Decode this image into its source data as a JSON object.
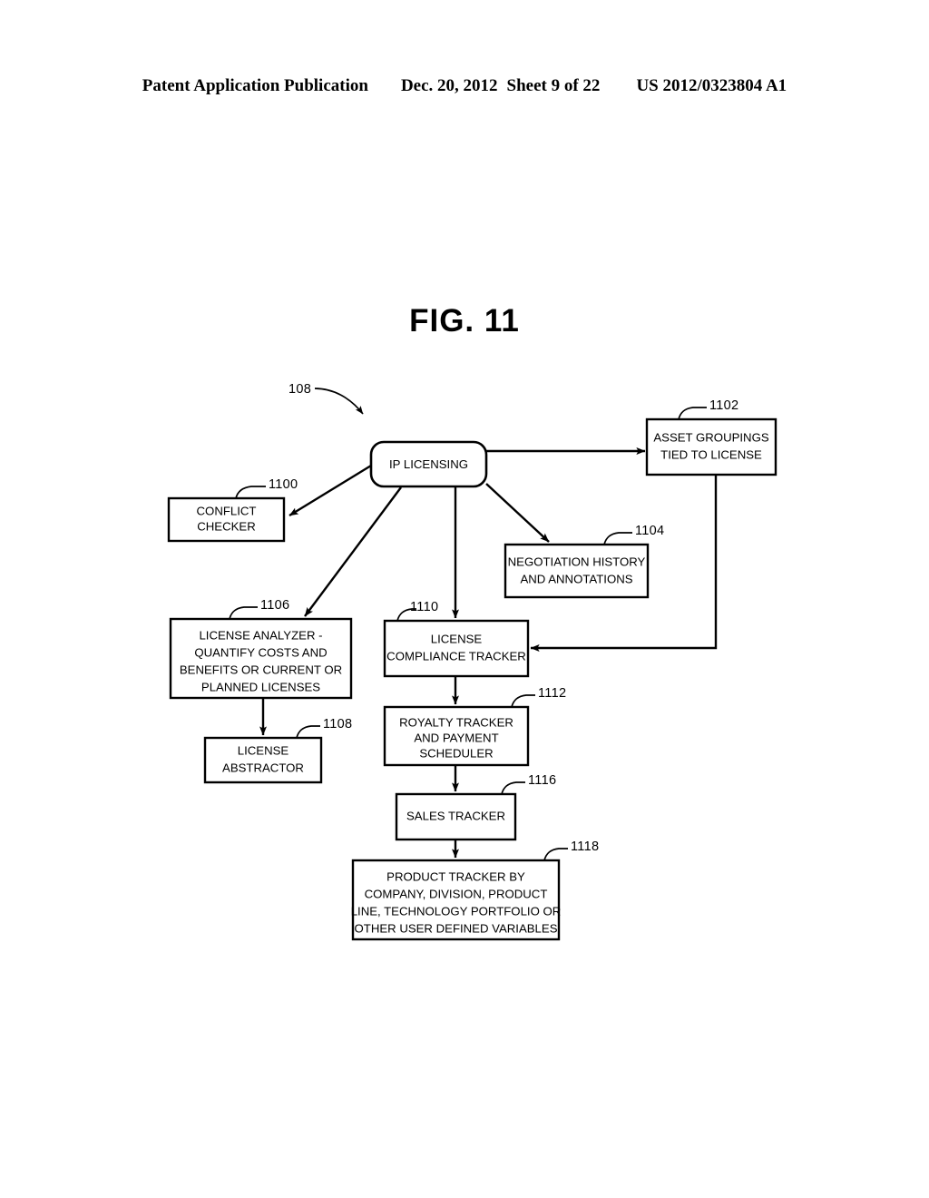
{
  "header": {
    "publication": "Patent Application Publication",
    "date": "Dec. 20, 2012",
    "sheet": "Sheet 9 of 22",
    "patent_number": "US 2012/0323804 A1"
  },
  "figure": {
    "title": "FIG. 11",
    "system_ref": "108"
  },
  "nodes": [
    {
      "id": "ip-licensing",
      "ref": "108",
      "label": "IP LICENSING",
      "lines": [
        "IP LICENSING"
      ],
      "shape": "rounded-rect"
    },
    {
      "id": "conflict-checker",
      "ref": "1100",
      "label": "CONFLICT CHECKER",
      "lines": [
        "CONFLICT",
        "CHECKER"
      ],
      "shape": "rect"
    },
    {
      "id": "asset-groupings",
      "ref": "1102",
      "label": "ASSET GROUPINGS TIED TO LICENSE",
      "lines": [
        "ASSET GROUPINGS",
        "TIED TO LICENSE"
      ],
      "shape": "rect"
    },
    {
      "id": "negotiation-history",
      "ref": "1104",
      "label": "NEGOTIATION HISTORY AND ANNOTATIONS",
      "lines": [
        "NEGOTIATION HISTORY",
        "AND ANNOTATIONS"
      ],
      "shape": "rect"
    },
    {
      "id": "license-analyzer",
      "ref": "1106",
      "label": "LICENSE ANALYZER - QUANTIFY COSTS AND BENEFITS OR CURRENT OR PLANNED LICENSES",
      "lines": [
        "LICENSE ANALYZER -",
        "QUANTIFY COSTS AND",
        "BENEFITS OR CURRENT OR",
        "PLANNED LICENSES"
      ],
      "shape": "rect"
    },
    {
      "id": "license-abstractor",
      "ref": "1108",
      "label": "LICENSE ABSTRACTOR",
      "lines": [
        "LICENSE",
        "ABSTRACTOR"
      ],
      "shape": "rect"
    },
    {
      "id": "license-compliance-tracker",
      "ref": "1110",
      "label": "LICENSE COMPLIANCE TRACKER",
      "lines": [
        "LICENSE",
        "COMPLIANCE TRACKER"
      ],
      "shape": "rect"
    },
    {
      "id": "royalty-tracker",
      "ref": "1112",
      "label": "ROYALTY TRACKER AND PAYMENT SCHEDULER",
      "lines": [
        "ROYALTY TRACKER",
        "AND PAYMENT",
        "SCHEDULER"
      ],
      "shape": "rect"
    },
    {
      "id": "sales-tracker",
      "ref": "1116",
      "label": "SALES TRACKER",
      "lines": [
        "SALES TRACKER"
      ],
      "shape": "rect"
    },
    {
      "id": "product-tracker",
      "ref": "1118",
      "label": "PRODUCT TRACKER BY COMPANY, DIVISION, PRODUCT LINE, TECHNOLOGY PORTFOLIO OR OTHER USER DEFINED VARIABLES",
      "lines": [
        "PRODUCT TRACKER BY",
        "COMPANY, DIVISION, PRODUCT",
        "LINE, TECHNOLOGY PORTFOLIO OR",
        "OTHER USER DEFINED VARIABLES"
      ],
      "shape": "rect"
    }
  ],
  "edges": [
    {
      "from": "ip-licensing",
      "to": "conflict-checker"
    },
    {
      "from": "ip-licensing",
      "to": "asset-groupings"
    },
    {
      "from": "ip-licensing",
      "to": "negotiation-history"
    },
    {
      "from": "ip-licensing",
      "to": "license-analyzer"
    },
    {
      "from": "ip-licensing",
      "to": "license-compliance-tracker"
    },
    {
      "from": "license-analyzer",
      "to": "license-abstractor"
    },
    {
      "from": "asset-groupings",
      "to": "license-compliance-tracker"
    },
    {
      "from": "license-compliance-tracker",
      "to": "royalty-tracker"
    },
    {
      "from": "royalty-tracker",
      "to": "sales-tracker"
    },
    {
      "from": "sales-tracker",
      "to": "product-tracker"
    }
  ],
  "colors": {
    "ink": "#000000",
    "paper": "#ffffff"
  }
}
